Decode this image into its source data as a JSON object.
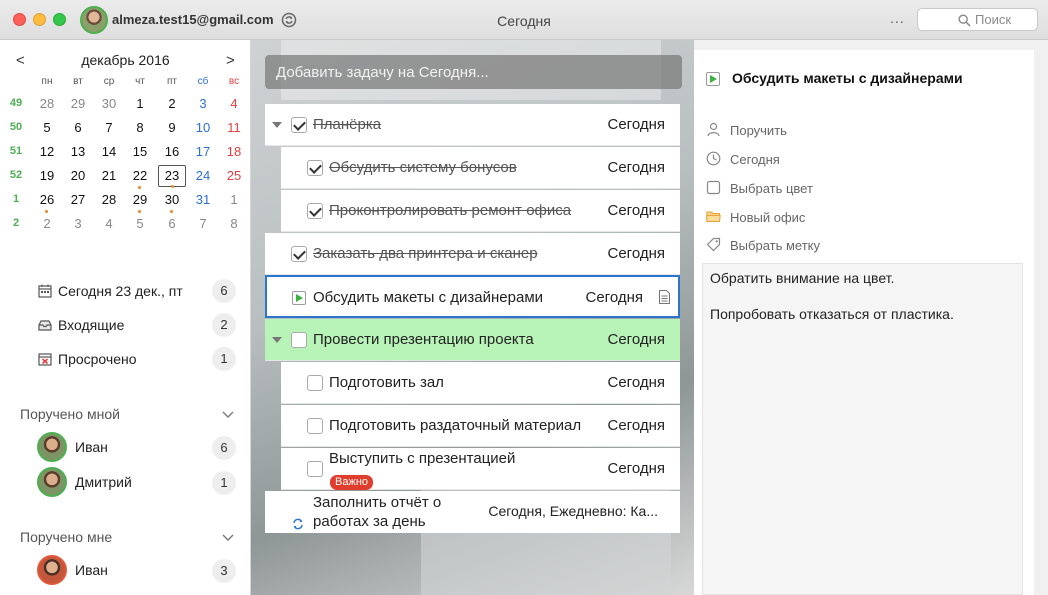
{
  "titlebar": {
    "account_email": "almeza.test15@gmail.com",
    "window_title": "Сегодня",
    "more_label": "...",
    "search_placeholder": "Поиск"
  },
  "calendar": {
    "month_label": "декабрь 2016",
    "prev_label": "<",
    "next_label": ">",
    "weekdays": [
      "пн",
      "вт",
      "ср",
      "чт",
      "пт",
      "сб",
      "вс"
    ],
    "weeks": [
      {
        "num": "49",
        "days": [
          "28",
          "29",
          "30",
          "1",
          "2",
          "3",
          "4"
        ]
      },
      {
        "num": "50",
        "days": [
          "5",
          "6",
          "7",
          "8",
          "9",
          "10",
          "11"
        ]
      },
      {
        "num": "51",
        "days": [
          "12",
          "13",
          "14",
          "15",
          "16",
          "17",
          "18"
        ]
      },
      {
        "num": "52",
        "days": [
          "19",
          "20",
          "21",
          "22",
          "23",
          "24",
          "25"
        ]
      },
      {
        "num": "1",
        "days": [
          "26",
          "27",
          "28",
          "29",
          "30",
          "31",
          "1"
        ]
      },
      {
        "num": "2",
        "days": [
          "2",
          "3",
          "4",
          "5",
          "6",
          "7",
          "8"
        ]
      }
    ]
  },
  "nav": {
    "today": {
      "label": "Сегодня 23 дек., пт",
      "count": "6"
    },
    "inbox": {
      "label": "Входящие",
      "count": "2"
    },
    "overdue": {
      "label": "Просрочено",
      "count": "1"
    }
  },
  "assigned_by_me": {
    "title": "Поручено мной",
    "people": [
      {
        "name": "Иван",
        "count": "6"
      },
      {
        "name": "Дмитрий",
        "count": "1"
      }
    ]
  },
  "assigned_to_me": {
    "title": "Поручено мне",
    "people": [
      {
        "name": "Иван",
        "count": "3"
      }
    ]
  },
  "add_task_placeholder": "Добавить задачу на Сегодня...",
  "tasks": [
    {
      "title": "Планёрка",
      "date": "Сегодня"
    },
    {
      "title": "Обсудить систему бонусов",
      "date": "Сегодня"
    },
    {
      "title": "Проконтролировать ремонт офиса",
      "date": "Сегодня"
    },
    {
      "title": "Заказать два принтера и сканер",
      "date": "Сегодня"
    },
    {
      "title": "Обсудить макеты с дизайнерами",
      "date": "Сегодня"
    },
    {
      "title": "Провести презентацию проекта",
      "date": "Сегодня"
    },
    {
      "title": "Подготовить зал",
      "date": "Сегодня"
    },
    {
      "title": "Подготовить раздаточный материал",
      "date": "Сегодня"
    },
    {
      "title": "Выступить с презентацией",
      "date": "Сегодня",
      "tag": "Важно"
    },
    {
      "title_line1": "Заполнить отчёт о",
      "title_line2": "работах за день",
      "date": "Сегодня, Ежедневно: Ка..."
    }
  ],
  "details": {
    "title": "Обсудить макеты с дизайнерами",
    "assign": "Поручить",
    "date": "Сегодня",
    "color": "Выбрать цвет",
    "folder": "Новый офис",
    "label": "Выбрать метку",
    "note_line1": "Обратить внимание на цвет.",
    "note_line2": "Попробовать отказаться от пластика."
  },
  "colors": {
    "accent_green": "#4caf50",
    "saturday": "#2b6fd6",
    "sunday": "#e04040",
    "selection_border": "#2a76cf",
    "highlight_row": "#b8f3b8",
    "important_tag": "#e03d2c"
  }
}
